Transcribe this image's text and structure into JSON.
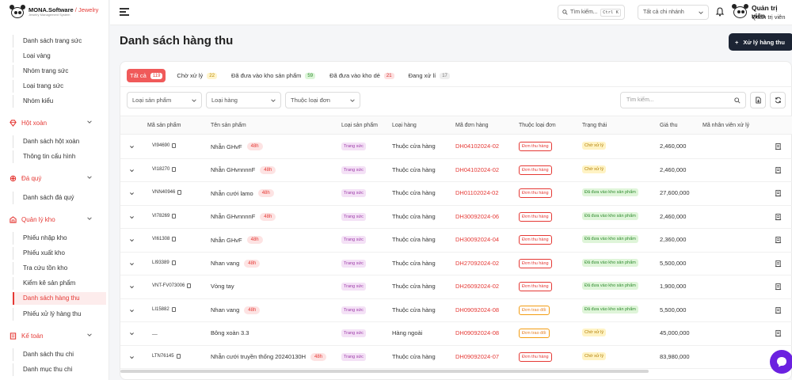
{
  "brand": {
    "name": "MONA.Software",
    "divider": " / ",
    "suffix": "Jewelry",
    "subtitle": "Jewelry Management System"
  },
  "sidebar": {
    "items": [
      {
        "label": "Danh sách trang sức",
        "kind": "sub"
      },
      {
        "label": "Loại vàng",
        "kind": "sub"
      },
      {
        "label": "Nhóm trang sức",
        "kind": "sub"
      },
      {
        "label": "Loại trang sức",
        "kind": "sub"
      },
      {
        "label": "Nhóm kiểu",
        "kind": "sub"
      },
      {
        "label": "Hột xoàn",
        "kind": "group",
        "icon": "diamond-icon"
      },
      {
        "label": "Danh sách hột xoàn",
        "kind": "sub"
      },
      {
        "label": "Thông tin cấu hình",
        "kind": "sub"
      },
      {
        "label": "Đá quý",
        "kind": "group",
        "icon": "gem-icon"
      },
      {
        "label": "Danh sách đá quý",
        "kind": "sub"
      },
      {
        "label": "Quản lý kho",
        "kind": "group",
        "icon": "warehouse-icon"
      },
      {
        "label": "Phiếu nhập kho",
        "kind": "sub"
      },
      {
        "label": "Phiếu xuất kho",
        "kind": "sub"
      },
      {
        "label": "Tra cứu tồn kho",
        "kind": "sub"
      },
      {
        "label": "Kiểm kê sản phẩm",
        "kind": "sub"
      },
      {
        "label": "Danh sách hàng thu",
        "kind": "sub",
        "active": true
      },
      {
        "label": "Phiếu xử lý hàng thu",
        "kind": "sub"
      },
      {
        "label": "Kế toán",
        "kind": "group",
        "icon": "accounting-icon"
      },
      {
        "label": "Danh sách thu chi",
        "kind": "sub"
      },
      {
        "label": "Danh mục thu chi",
        "kind": "sub"
      }
    ]
  },
  "topbar": {
    "search_label": "Tìm kiếm...",
    "shortcut": "Ctrl K",
    "branch": "Tất cả chi nhánh",
    "user_name": "Quản trị viên",
    "user_role": "Quản trị viên"
  },
  "page": {
    "title": "Danh sách hàng thu",
    "action_label": "Xử lý hàng thu"
  },
  "tabs": [
    {
      "label": "Tất cả",
      "count": "119",
      "color": "active"
    },
    {
      "label": "Chờ xử lý",
      "count": "22",
      "color": "y"
    },
    {
      "label": "Đã đưa vào kho sản phẩm",
      "count": "59",
      "color": "g"
    },
    {
      "label": "Đã đưa vào kho dẻ",
      "count": "21",
      "color": "r"
    },
    {
      "label": "Đang xử lí",
      "count": "17",
      "color": "gr"
    }
  ],
  "filters": {
    "product_type": "Loại sản phẩm",
    "goods_type": "Loại hàng",
    "order_type": "Thuộc loại đơn",
    "search_placeholder": "Tìm kiếm..."
  },
  "table": {
    "columns": [
      "Mã sản phẩm",
      "Tên sản phẩm",
      "Loại sản phẩm",
      "Loại hàng",
      "Mã đơn hàng",
      "Thuộc loại đơn",
      "Trạng thái",
      "Giá thu",
      "Mã nhân viên xử lý"
    ],
    "rows": [
      {
        "code": "VI94690",
        "name": "Nhẫn GHvF",
        "badge": "48h",
        "ptype": "Trang sức",
        "gtype": "Thuộc cửa hàng",
        "order": "DH04102024-02",
        "otype": "Đơn thu hàng",
        "ocolor": "red",
        "status": "Chờ xử lý",
        "scolor": "y",
        "price": "2,460,000"
      },
      {
        "code": "VI18270",
        "name": "Nhẫn GHvnnnnF",
        "badge": "48h",
        "ptype": "Trang sức",
        "gtype": "Thuộc cửa hàng",
        "order": "DH04102024-02",
        "otype": "Đơn thu hàng",
        "ocolor": "red",
        "status": "Chờ xử lý",
        "scolor": "y",
        "price": "2,460,000"
      },
      {
        "code": "VNN40946",
        "name": "Nhẫn cưới lamo",
        "badge": "48h",
        "ptype": "Trang sức",
        "gtype": "Thuộc cửa hàng",
        "order": "DH01102024-02",
        "otype": "Đơn thu hàng",
        "ocolor": "red",
        "status": "Đã đưa vào kho sản phẩm",
        "scolor": "g",
        "price": "27,600,000"
      },
      {
        "code": "VI78269",
        "name": "Nhẫn GHvnnnnF",
        "badge": "48h",
        "ptype": "Trang sức",
        "gtype": "Thuộc cửa hàng",
        "order": "DH30092024-06",
        "otype": "Đơn thu hàng",
        "ocolor": "red",
        "status": "Đã đưa vào kho sản phẩm",
        "scolor": "g",
        "price": "2,460,000"
      },
      {
        "code": "VI61308",
        "name": "Nhẫn GHvF",
        "badge": "48h",
        "ptype": "Trang sức",
        "gtype": "Thuộc cửa hàng",
        "order": "DH30092024-04",
        "otype": "Đơn thu hàng",
        "ocolor": "red",
        "status": "Đã đưa vào kho sản phẩm",
        "scolor": "g",
        "price": "2,360,000"
      },
      {
        "code": "LI93389",
        "name": "Nhan vang",
        "badge": "48h",
        "ptype": "Trang sức",
        "gtype": "Thuộc cửa hàng",
        "order": "DH27092024-02",
        "otype": "Đơn thu hàng",
        "ocolor": "red",
        "status": "Đã đưa vào kho sản phẩm",
        "scolor": "g",
        "price": "5,500,000"
      },
      {
        "code": "VNT-FV073006",
        "name": "Vòng tay",
        "badge": "",
        "ptype": "Trang sức",
        "gtype": "Thuộc cửa hàng",
        "order": "DH26092024-02",
        "otype": "Đơn thu hàng",
        "ocolor": "red",
        "status": "Đã đưa vào kho sản phẩm",
        "scolor": "g",
        "price": "1,900,000"
      },
      {
        "code": "LI15882",
        "name": "Nhan vang",
        "badge": "48h",
        "ptype": "Trang sức",
        "gtype": "Thuộc cửa hàng",
        "order": "DH09092024-08",
        "otype": "Đơn trao đổi",
        "ocolor": "orange",
        "status": "Đã đưa vào kho sản phẩm",
        "scolor": "g",
        "price": "5,500,000"
      },
      {
        "code": "__",
        "name": "Bông xoàn 3.3",
        "badge": "",
        "ptype": "Trang sức",
        "gtype": "Hàng ngoài",
        "order": "DH09092024-08",
        "otype": "Đơn trao đổi",
        "ocolor": "orange",
        "status": "Chờ xử lý",
        "scolor": "y",
        "price": "45,000,000"
      },
      {
        "code": "LTN76145",
        "name": "Nhẫn cưới truyền thống 20240130H",
        "badge": "48h",
        "ptype": "Trang sức",
        "gtype": "Thuộc cửa hàng",
        "order": "DH09092024-07",
        "otype": "Đơn thu hàng",
        "ocolor": "red",
        "status": "Chờ xử lý",
        "scolor": "y",
        "price": "83,980,000"
      }
    ]
  },
  "colors": {
    "accent": "#e53935",
    "dark_button": "#1c2434",
    "chat": "#6b21e0"
  }
}
